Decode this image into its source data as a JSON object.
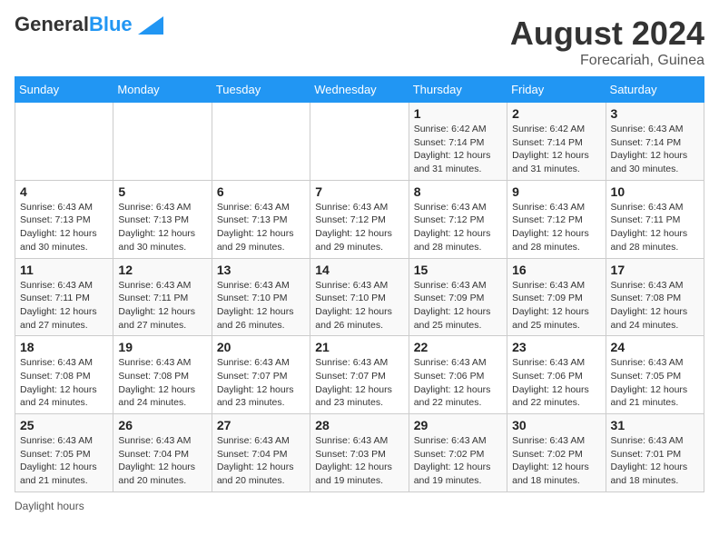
{
  "header": {
    "logo_general": "General",
    "logo_blue": "Blue",
    "month_year": "August 2024",
    "location": "Forecariah, Guinea"
  },
  "days_of_week": [
    "Sunday",
    "Monday",
    "Tuesday",
    "Wednesday",
    "Thursday",
    "Friday",
    "Saturday"
  ],
  "footer": {
    "daylight_hours": "Daylight hours"
  },
  "weeks": [
    [
      {
        "day": "",
        "info": ""
      },
      {
        "day": "",
        "info": ""
      },
      {
        "day": "",
        "info": ""
      },
      {
        "day": "",
        "info": ""
      },
      {
        "day": "1",
        "info": "Sunrise: 6:42 AM\nSunset: 7:14 PM\nDaylight: 12 hours\nand 31 minutes."
      },
      {
        "day": "2",
        "info": "Sunrise: 6:42 AM\nSunset: 7:14 PM\nDaylight: 12 hours\nand 31 minutes."
      },
      {
        "day": "3",
        "info": "Sunrise: 6:43 AM\nSunset: 7:14 PM\nDaylight: 12 hours\nand 30 minutes."
      }
    ],
    [
      {
        "day": "4",
        "info": "Sunrise: 6:43 AM\nSunset: 7:13 PM\nDaylight: 12 hours\nand 30 minutes."
      },
      {
        "day": "5",
        "info": "Sunrise: 6:43 AM\nSunset: 7:13 PM\nDaylight: 12 hours\nand 30 minutes."
      },
      {
        "day": "6",
        "info": "Sunrise: 6:43 AM\nSunset: 7:13 PM\nDaylight: 12 hours\nand 29 minutes."
      },
      {
        "day": "7",
        "info": "Sunrise: 6:43 AM\nSunset: 7:12 PM\nDaylight: 12 hours\nand 29 minutes."
      },
      {
        "day": "8",
        "info": "Sunrise: 6:43 AM\nSunset: 7:12 PM\nDaylight: 12 hours\nand 28 minutes."
      },
      {
        "day": "9",
        "info": "Sunrise: 6:43 AM\nSunset: 7:12 PM\nDaylight: 12 hours\nand 28 minutes."
      },
      {
        "day": "10",
        "info": "Sunrise: 6:43 AM\nSunset: 7:11 PM\nDaylight: 12 hours\nand 28 minutes."
      }
    ],
    [
      {
        "day": "11",
        "info": "Sunrise: 6:43 AM\nSunset: 7:11 PM\nDaylight: 12 hours\nand 27 minutes."
      },
      {
        "day": "12",
        "info": "Sunrise: 6:43 AM\nSunset: 7:11 PM\nDaylight: 12 hours\nand 27 minutes."
      },
      {
        "day": "13",
        "info": "Sunrise: 6:43 AM\nSunset: 7:10 PM\nDaylight: 12 hours\nand 26 minutes."
      },
      {
        "day": "14",
        "info": "Sunrise: 6:43 AM\nSunset: 7:10 PM\nDaylight: 12 hours\nand 26 minutes."
      },
      {
        "day": "15",
        "info": "Sunrise: 6:43 AM\nSunset: 7:09 PM\nDaylight: 12 hours\nand 25 minutes."
      },
      {
        "day": "16",
        "info": "Sunrise: 6:43 AM\nSunset: 7:09 PM\nDaylight: 12 hours\nand 25 minutes."
      },
      {
        "day": "17",
        "info": "Sunrise: 6:43 AM\nSunset: 7:08 PM\nDaylight: 12 hours\nand 24 minutes."
      }
    ],
    [
      {
        "day": "18",
        "info": "Sunrise: 6:43 AM\nSunset: 7:08 PM\nDaylight: 12 hours\nand 24 minutes."
      },
      {
        "day": "19",
        "info": "Sunrise: 6:43 AM\nSunset: 7:08 PM\nDaylight: 12 hours\nand 24 minutes."
      },
      {
        "day": "20",
        "info": "Sunrise: 6:43 AM\nSunset: 7:07 PM\nDaylight: 12 hours\nand 23 minutes."
      },
      {
        "day": "21",
        "info": "Sunrise: 6:43 AM\nSunset: 7:07 PM\nDaylight: 12 hours\nand 23 minutes."
      },
      {
        "day": "22",
        "info": "Sunrise: 6:43 AM\nSunset: 7:06 PM\nDaylight: 12 hours\nand 22 minutes."
      },
      {
        "day": "23",
        "info": "Sunrise: 6:43 AM\nSunset: 7:06 PM\nDaylight: 12 hours\nand 22 minutes."
      },
      {
        "day": "24",
        "info": "Sunrise: 6:43 AM\nSunset: 7:05 PM\nDaylight: 12 hours\nand 21 minutes."
      }
    ],
    [
      {
        "day": "25",
        "info": "Sunrise: 6:43 AM\nSunset: 7:05 PM\nDaylight: 12 hours\nand 21 minutes."
      },
      {
        "day": "26",
        "info": "Sunrise: 6:43 AM\nSunset: 7:04 PM\nDaylight: 12 hours\nand 20 minutes."
      },
      {
        "day": "27",
        "info": "Sunrise: 6:43 AM\nSunset: 7:04 PM\nDaylight: 12 hours\nand 20 minutes."
      },
      {
        "day": "28",
        "info": "Sunrise: 6:43 AM\nSunset: 7:03 PM\nDaylight: 12 hours\nand 19 minutes."
      },
      {
        "day": "29",
        "info": "Sunrise: 6:43 AM\nSunset: 7:02 PM\nDaylight: 12 hours\nand 19 minutes."
      },
      {
        "day": "30",
        "info": "Sunrise: 6:43 AM\nSunset: 7:02 PM\nDaylight: 12 hours\nand 18 minutes."
      },
      {
        "day": "31",
        "info": "Sunrise: 6:43 AM\nSunset: 7:01 PM\nDaylight: 12 hours\nand 18 minutes."
      }
    ]
  ]
}
